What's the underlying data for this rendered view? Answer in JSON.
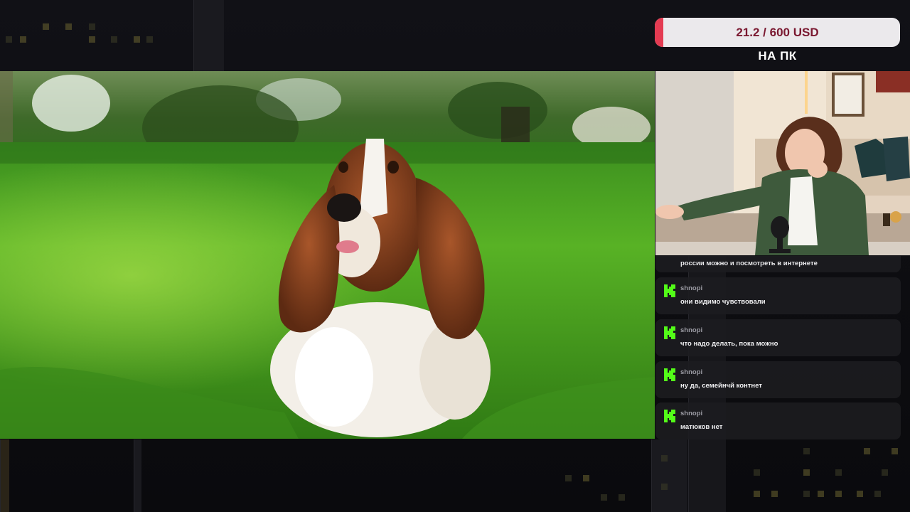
{
  "goal": {
    "text": "21.2 / 600 USD",
    "caption": "НА ПК",
    "progress_fraction": 0.035,
    "fill_color": "#e43b52"
  },
  "photo": {
    "subject": "basset-hound-on-grass"
  },
  "chat": {
    "top_line": "россии можно и посмотреть в интернете",
    "badge_color": "#53fc18",
    "messages": [
      {
        "user": "shnopi",
        "text": "они видимо чувствовали"
      },
      {
        "user": "shnopi",
        "text": "что надо делать, пока можно"
      },
      {
        "user": "shnopi",
        "text": "ну да, семейнчй контнет"
      },
      {
        "user": "shnopi",
        "text": "матюков нет"
      }
    ]
  }
}
